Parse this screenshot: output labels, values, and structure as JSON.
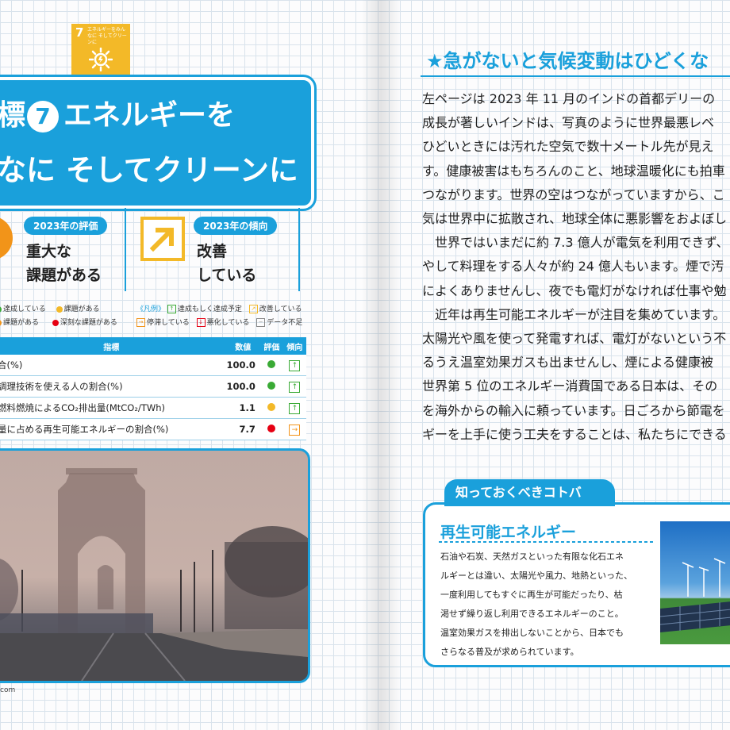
{
  "sdg": {
    "number": "7",
    "short_title": "エネルギーをみんなに そしてクリーンに",
    "icon": "sun-power-icon",
    "color": "#f3b928"
  },
  "title": {
    "goal_prefix": "標",
    "goal_number": "7",
    "line1": "エネルギーを",
    "line2": "なに そしてクリーンに"
  },
  "evaluation": {
    "label": "2023年の評価",
    "value_line1": "重大な",
    "value_line2": "課題がある",
    "color": "#f29419"
  },
  "trend": {
    "label": "2023年の傾向",
    "value_line1": "改善",
    "value_line2": "している",
    "icon": "arrow-up-right-icon"
  },
  "legend": {
    "eval_items": [
      "達成している",
      "課題がある",
      "課題がある",
      "深刻な課題がある"
    ],
    "title": "《凡例》",
    "trend_items": [
      "達成もしく達成予定",
      "改善している",
      "停滞している",
      "悪化している",
      "データ不足"
    ]
  },
  "table": {
    "headers": [
      "指標",
      "数値",
      "評価",
      "傾向"
    ],
    "rows": [
      {
        "name": "合(%)",
        "value": "100.0",
        "eval_color": "#3aaa35",
        "trend": "↑",
        "trend_color": "#3aaa35"
      },
      {
        "name": "調理技術を使える人の割合(%)",
        "value": "100.0",
        "eval_color": "#3aaa35",
        "trend": "↑",
        "trend_color": "#3aaa35"
      },
      {
        "name": "燃料燃焼によるCO₂排出量(MtCO₂/TWh)",
        "value": "1.1",
        "eval_color": "#f3b928",
        "trend": "↑",
        "trend_color": "#3aaa35"
      },
      {
        "name": "量に占める再生可能エネルギーの割合(%)",
        "value": "7.7",
        "eval_color": "#e60012",
        "trend": "→",
        "trend_color": "#f29419"
      }
    ]
  },
  "photo_credit": "com",
  "section": {
    "heading": "★急がないと気候変動はひどくな",
    "paragraphs": [
      "左ページは 2023 年 11 月のインドの首都デリーの",
      "成長が著しいインドは、写真のように世界最悪レベ",
      "ひどいときには汚れた空気で数十メートル先が見え",
      "す。健康被害はもちろんのこと、地球温暖化にも拍車",
      "つながります。世界の空はつながっていますから、こ",
      "気は世界中に拡散され、地球全体に悪影響をおよぼし",
      "　世界ではいまだに約 7.3 億人が電気を利用できず、",
      "やして料理をする人々が約 24 億人もいます。煙で汚",
      "によくありませんし、夜でも電灯がなければ仕事や勉",
      "　近年は再生可能エネルギーが注目を集めています。",
      "太陽光や風を使って発電すれば、電灯がないという不",
      "るうえ温室効果ガスも出ませんし、煙による健康被",
      "世界第 5 位のエネルギー消費国である日本は、その",
      "を海外からの輸入に頼っています。日ごろから節電を",
      "ギーを上手に使う工夫をすることは、私たちにできる"
    ]
  },
  "kotoba": {
    "tab_label": "知っておくべきコトバ",
    "term": "再生可能エネルギー",
    "lines": [
      "石油や石炭、天然ガスといった有限な化石エネ",
      "ルギーとは違い、太陽光や風力、地熱といった、",
      "一度利用してもすぐに再生が可能だったり、枯",
      "渇せず繰り返し利用できるエネルギーのこと。",
      "温室効果ガスを排出しないことから、日本でも",
      "さらなる普及が求められています。"
    ]
  }
}
